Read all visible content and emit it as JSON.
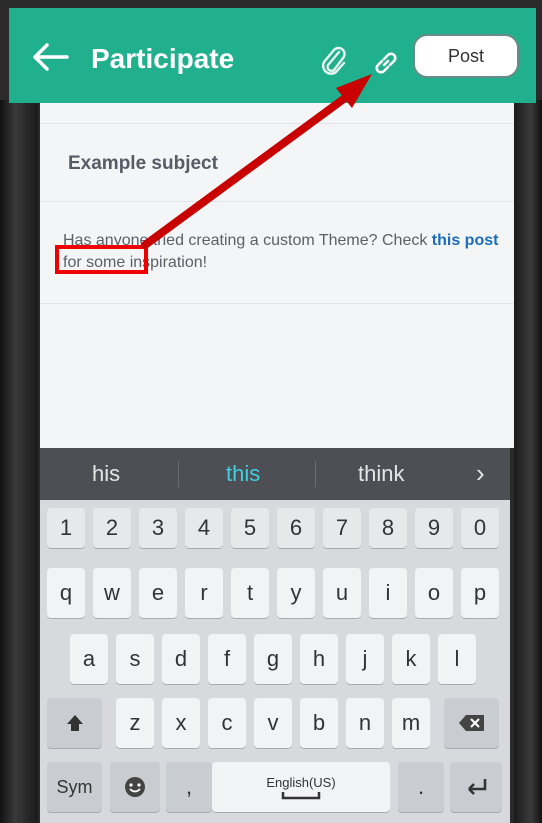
{
  "header": {
    "title": "Participate",
    "post_label": "Post",
    "icons": [
      "arrow-left-icon",
      "paperclip-icon",
      "link-icon"
    ],
    "color": "#20b08d"
  },
  "post": {
    "subject": "Example subject",
    "body_before": "Has anyone tried creating a custom Theme? Check ",
    "body_link": "this post",
    "body_after": " for some inspiration!"
  },
  "suggestions": {
    "left": "his",
    "center": "this",
    "right": "think",
    "more": "›"
  },
  "keyboard": {
    "numbers": [
      "1",
      "2",
      "3",
      "4",
      "5",
      "6",
      "7",
      "8",
      "9",
      "0"
    ],
    "row1": [
      "q",
      "w",
      "e",
      "r",
      "t",
      "y",
      "u",
      "i",
      "o",
      "p"
    ],
    "row2": [
      "a",
      "s",
      "d",
      "f",
      "g",
      "h",
      "j",
      "k",
      "l"
    ],
    "row3": [
      "z",
      "x",
      "c",
      "v",
      "b",
      "n",
      "m"
    ],
    "sym_label": "Sym",
    "comma": ",",
    "period": ".",
    "space_label": "English(US)"
  },
  "annotation_color": "#e00000"
}
